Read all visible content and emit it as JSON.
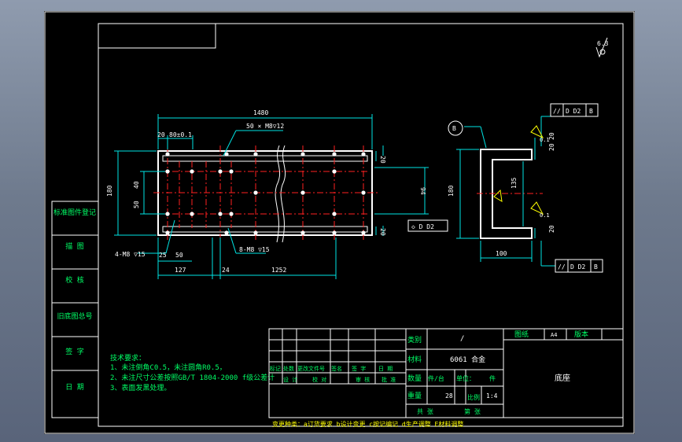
{
  "colors": {
    "frame": "#ffffff",
    "cyan": "#00e5e5",
    "green": "#00ff66",
    "red": "#ff2020",
    "yellow": "#ffff00",
    "white": "#ffffff"
  },
  "roughness_mark": "6.3",
  "top_view": {
    "overall_length": "1480",
    "dim_20": "20",
    "dim_80": "80±0.1",
    "holes_note": "50 × M8▽12",
    "height": "180",
    "dim_40": "40",
    "dim_50": "50",
    "right_20a": "20",
    "right_20b": "20",
    "dim_94": "94",
    "counterbore_left": "4-M8 ▽15",
    "dim_25": "25",
    "dim_50b": "50",
    "counterbore_mid": "8-M8 ▽15",
    "dim_127": "127",
    "dim_24": "24",
    "dim_1252": "1252",
    "pos_tol": "◇ D D2"
  },
  "section_view": {
    "datum_b": "B",
    "height": "180",
    "dim_135": "135",
    "dim_100": "100",
    "right_20a": "20",
    "right_20b": "20",
    "right_20c": "20",
    "parallel_top": [
      "//",
      "D D2",
      "B"
    ],
    "parallel_bottom": [
      "//",
      "D D2",
      "B"
    ],
    "flatness_a": "0.1",
    "flatness_b": "0.1"
  },
  "left_column": [
    "标准图件登记",
    "描  图",
    "校  核",
    "旧底图总号",
    "签  字",
    "日  期"
  ],
  "tech_req": {
    "title": "技术要求：",
    "lines": [
      "1、未注倒角C0.5，未注圆角R0.5，",
      "2、未注尺寸公差按照GB/T 1804-2000 f级公差计",
      "3、表面发黑处理。"
    ]
  },
  "title_block": {
    "type_label": "类别",
    "type_value": "/",
    "material_label": "材料",
    "material_value": "6061 合金",
    "drawing_no_label": "图纸",
    "drawing_no_value": "A4",
    "version_label": "版本",
    "part_name": "底座",
    "qty_label": "数量",
    "qty_units": "件/台",
    "unit_label": "单位：",
    "unit_value": "件",
    "weight_label": "重量",
    "weight_value": "28",
    "ratio_label": "比例",
    "ratio_value": "1:4",
    "sheets_label": "共  张",
    "sheet_label": "第  张",
    "rev_row": [
      "标记",
      "处数",
      "更改文件号",
      "签名",
      "签  字",
      "日  期"
    ],
    "sign_row": [
      "设 计",
      "校 对",
      "审 核",
      "批 准"
    ]
  },
  "change_note": "变更种类：a订货要求 b设计变更 c按记编记 d生产调整 E材料调整"
}
